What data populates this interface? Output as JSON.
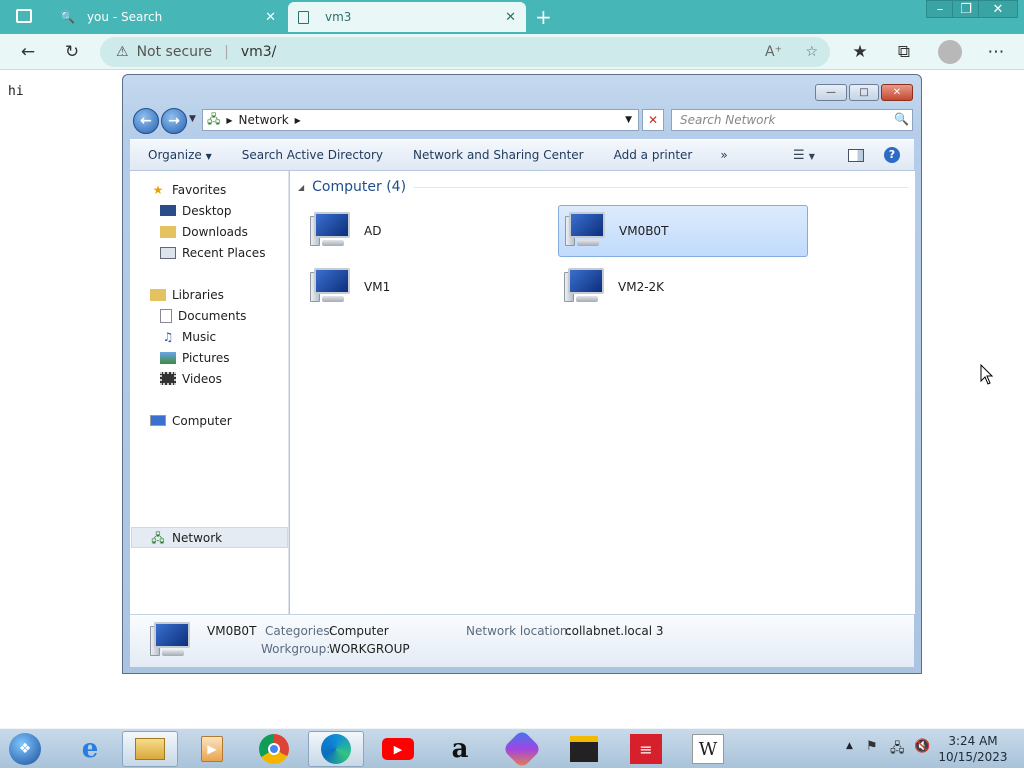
{
  "browser": {
    "tabs": [
      {
        "label": "you - Search"
      },
      {
        "label": "vm3"
      }
    ],
    "not_secure": "Not secure",
    "url": "vm3/"
  },
  "page": {
    "text": "hi"
  },
  "explorer": {
    "breadcrumb": "Network",
    "search_placeholder": "Search Network",
    "commands": [
      "Organize",
      "Search Active Directory",
      "Network and Sharing Center",
      "Add a printer"
    ],
    "sidebar": {
      "favorites": "Favorites",
      "favorites_items": [
        "Desktop",
        "Downloads",
        "Recent Places"
      ],
      "libraries": "Libraries",
      "libraries_items": [
        "Documents",
        "Music",
        "Pictures",
        "Videos"
      ],
      "computer": "Computer",
      "network": "Network"
    },
    "group_header": "Computer (4)",
    "computers": [
      "AD",
      "VM0B0T",
      "VM1",
      "VM2-2K"
    ],
    "details": {
      "name": "VM0B0T",
      "categories_label": "Categories:",
      "categories_value": "Computer",
      "workgroup_label": "Workgroup:",
      "workgroup_value": "WORKGROUP",
      "network_location_label": "Network location:",
      "network_location_value": "collabnet.local 3"
    }
  },
  "taskbar": {
    "time": "3:24 AM",
    "date": "10/15/2023"
  },
  "colors": {
    "browser_tabbar": "#47b6b6",
    "browser_toolbar": "#e9f7f7",
    "selection": "#c1dbfc",
    "group_header": "#1e4e8c"
  }
}
